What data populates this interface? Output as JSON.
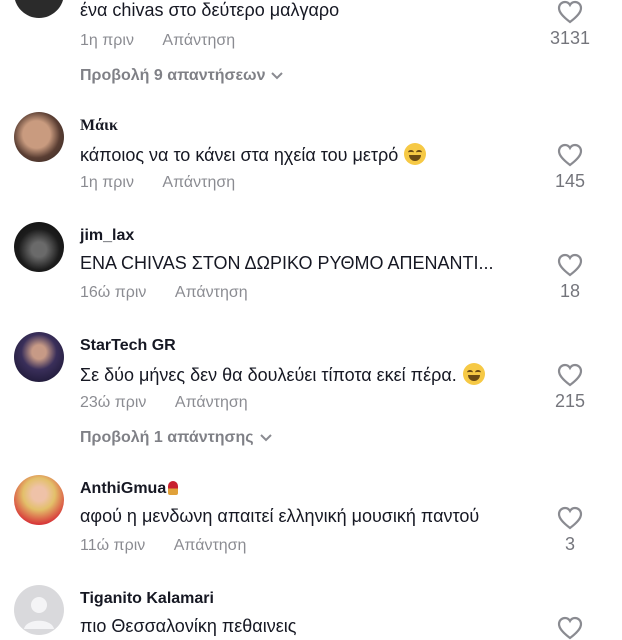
{
  "comments": [
    {
      "username": "",
      "text": "ένα chivas στο δεύτερο μαλγαρο",
      "time": "1η πριν",
      "reply_label": "Απάντηση",
      "likes": "3131",
      "view_replies": "Προβολή 9 απαντήσεων"
    },
    {
      "username": "Μάικ",
      "text": "κάποιος να το κάνει στα ηχεία του μετρό",
      "time": "1η πριν",
      "reply_label": "Απάντηση",
      "likes": "145"
    },
    {
      "username": "jim_lax",
      "text": "ΕΝΑ CHIVAS ΣΤΟΝ ΔΩΡΙΚΟ ΡΥΘΜΟ ΑΠΕΝΑΝΤΙ...",
      "time": "16ώ πριν",
      "reply_label": "Απάντηση",
      "likes": "18"
    },
    {
      "username": "StarTech GR",
      "text": "Σε δύο μήνες δεν θα δουλεύει τίποτα εκεί πέρα.",
      "time": "23ώ πριν",
      "reply_label": "Απάντηση",
      "likes": "215",
      "view_replies": "Προβολή 1 απάντησης"
    },
    {
      "username": "AnthiGmua",
      "text": "αφού η μενδωνη απαιτεί ελληνική μουσική παντού",
      "time": "11ώ πριν",
      "reply_label": "Απάντηση",
      "likes": "3"
    },
    {
      "username": "Tiganito Kalamari",
      "text": "πιο Θεσσαλονίκη πεθαινεις"
    }
  ],
  "colors": {
    "text": "#161823",
    "muted": "#8a8b91",
    "like_icon": "#8a8b91"
  }
}
